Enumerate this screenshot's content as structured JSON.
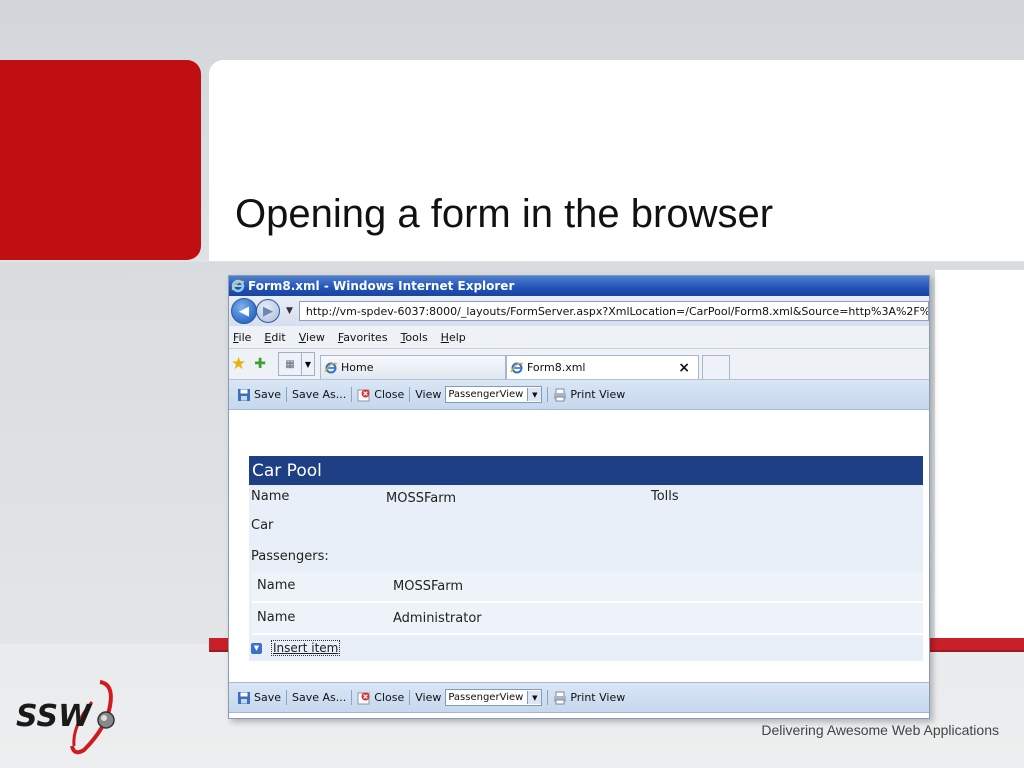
{
  "slide": {
    "title": "Opening a form in the browser",
    "tagline": "Delivering Awesome Web Applications",
    "logo_text": "SSW"
  },
  "browser": {
    "window_title": "Form8.xml - Windows Internet Explorer",
    "url": "http://vm-spdev-6037:8000/_layouts/FormServer.aspx?XmlLocation=/CarPool/Form8.xml&Source=http%3A%2F%",
    "menu": [
      "File",
      "Edit",
      "View",
      "Favorites",
      "Tools",
      "Help"
    ],
    "tabs": [
      {
        "label": "Home"
      },
      {
        "label": "Form8.xml"
      }
    ],
    "close_tab_glyph": "×"
  },
  "toolbar": {
    "save": "Save",
    "save_as": "Save As...",
    "close": "Close",
    "view": "View",
    "view_value": "PassengerView",
    "print_view": "Print View"
  },
  "form": {
    "title": "Car Pool",
    "name_label": "Name",
    "name_value": "MOSSFarm",
    "tolls_label": "Tolls",
    "car_label": "Car",
    "passengers_label": "Passengers:",
    "passengers": [
      {
        "label": "Name",
        "value": "MOSSFarm"
      },
      {
        "label": "Name",
        "value": "Administrator"
      }
    ],
    "insert_item": "Insert item"
  },
  "colors": {
    "accent_red": "#c00f13",
    "form_header": "#1e3f84",
    "form_body": "#e9eff8"
  }
}
